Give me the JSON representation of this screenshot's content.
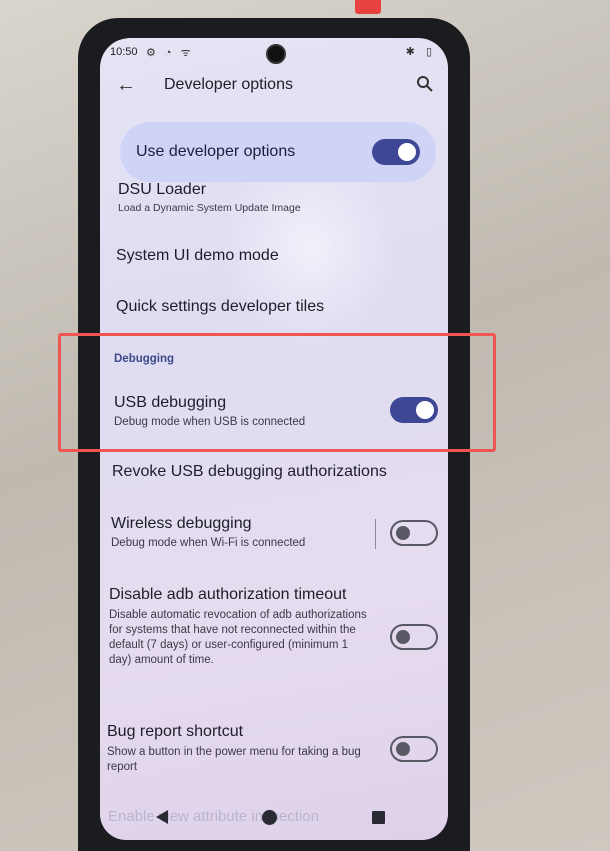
{
  "status_bar": {
    "time": "10:50",
    "left_icons": "⚙ ◔ ᯤ",
    "right_icons": "✱ ▯"
  },
  "app_bar": {
    "title": "Developer options"
  },
  "master_switch": {
    "label": "Use developer options",
    "enabled": true
  },
  "items": {
    "dsu": {
      "title": "DSU Loader",
      "summary": "Load a Dynamic System Update Image"
    },
    "demo": {
      "title": "System UI demo mode"
    },
    "tiles": {
      "title": "Quick settings developer tiles"
    },
    "usb": {
      "title": "USB debugging",
      "summary": "Debug mode when USB is connected",
      "enabled": true
    },
    "revoke": {
      "title": "Revoke USB debugging authorizations"
    },
    "wireless": {
      "title": "Wireless debugging",
      "summary": "Debug mode when Wi-Fi is connected",
      "enabled": false
    },
    "adb_timeout": {
      "title": "Disable adb authorization timeout",
      "summary": "Disable automatic revocation of adb authorizations for systems that have not reconnected within the default (7 days) or user-configured (minimum 1 day) amount of time.",
      "enabled": false
    },
    "bugreport": {
      "title": "Bug report shortcut",
      "summary": "Show a button in the power menu for taking a bug report",
      "enabled": false
    },
    "view_attr": {
      "title": "Enable view attribute inspection"
    }
  },
  "section": {
    "debugging": "Debugging"
  },
  "colors": {
    "accent": "#3e4796",
    "highlight_box": "#ef5652"
  }
}
